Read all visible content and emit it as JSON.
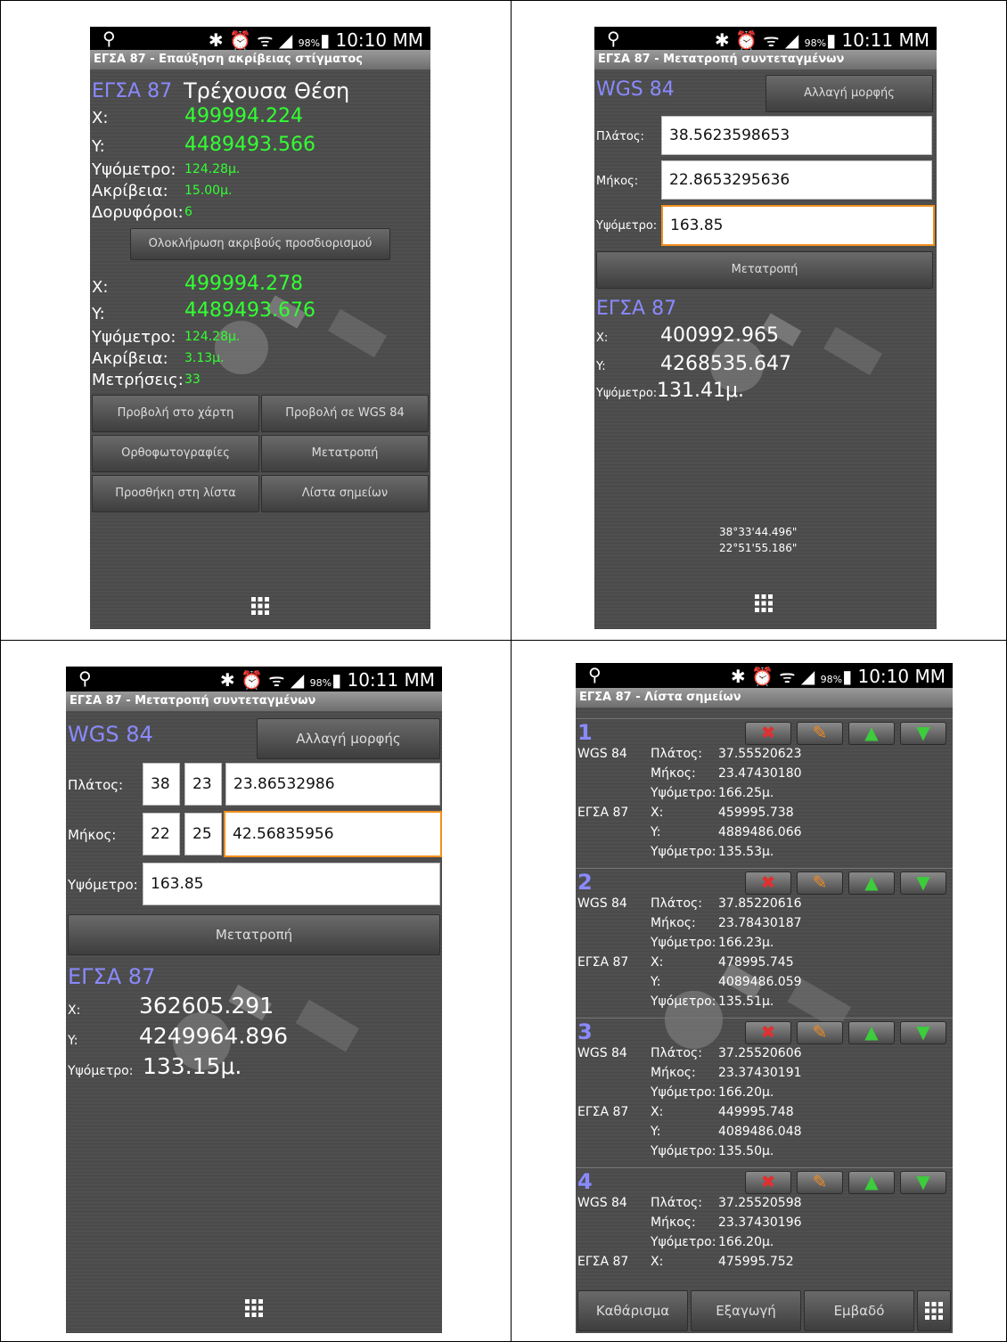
{
  "status": {
    "location_icon": "location-pin-icon",
    "icons": "✱ ⏰ ᯤ ◢",
    "battery": "98%",
    "time_a": "10:10 MM",
    "time_b": "10:11 MM"
  },
  "screen1": {
    "title": "ΕΓΣΑ 87 - Επαύξηση ακρίβειας στίγματος",
    "system": "ΕΓΣΑ 87",
    "current_position": "Τρέχουσα Θέση",
    "x_label": "X:",
    "x_value": "499994.224",
    "y_label": "Y:",
    "y_value": "4489493.566",
    "alt_label": "Υψόμετρο:",
    "alt_value": "124.28μ.",
    "acc_label": "Ακρίβεια:",
    "acc_value": "15.00μ.",
    "sat_label": "Δορυφόροι:",
    "sat_value": "6",
    "complete_button": "Ολοκλήρωση ακριβούς προσδιορισμού",
    "x2_label": "X:",
    "x2_value": "499994.278",
    "y2_label": "Y:",
    "y2_value": "4489493.676",
    "alt2_label": "Υψόμετρο:",
    "alt2_value": "124.28μ.",
    "acc2_label": "Ακρίβεια:",
    "acc2_value": "3.13μ.",
    "meas_label": "Μετρήσεις:",
    "meas_value": "33",
    "buttons": [
      "Προβολή στο χάρτη",
      "Προβολή σε WGS 84",
      "Ορθοφωτογραφίες",
      "Μετατροπή",
      "Προσθήκη στη λίστα",
      "Λίστα σημείων"
    ]
  },
  "screen2": {
    "title": "ΕΓΣΑ 87 - Μετατροπή συντεταγμένων",
    "system": "WGS 84",
    "change_format": "Αλλαγή μορφής",
    "lat_label": "Πλάτος:",
    "lat_value": "38.5623598653",
    "lon_label": "Μήκος:",
    "lon_value": "22.8653295636",
    "alt_label": "Υψόμετρο:",
    "alt_value": "163.85",
    "convert_button": "Μετατροπή",
    "result_system": "ΕΓΣΑ 87",
    "x_label": "X:",
    "x_value": "400992.965",
    "y_label": "Y:",
    "y_value": "4268535.647",
    "ralt_label": "Υψόμετρο:",
    "ralt_value": "131.41μ.",
    "dms_lat": "38°33'44.496\"",
    "dms_lon": "22°51'55.186\""
  },
  "screen3": {
    "title": "ΕΓΣΑ 87 - Μετατροπή συντεταγμένων",
    "system": "WGS 84",
    "change_format": "Αλλαγή μορφής",
    "lat_label": "Πλάτος:",
    "lat_deg": "38",
    "lat_min": "23",
    "lat_sec": "23.86532986",
    "lon_label": "Μήκος:",
    "lon_deg": "22",
    "lon_min": "25",
    "lon_sec": "42.56835956",
    "alt_label": "Υψόμετρο:",
    "alt_value": "163.85",
    "convert_button": "Μετατροπή",
    "result_system": "ΕΓΣΑ 87",
    "x_label": "X:",
    "x_value": "362605.291",
    "y_label": "Y:",
    "y_value": "4249964.896",
    "ralt_label": "Υψόμετρο:",
    "ralt_value": "133.15μ."
  },
  "screen4": {
    "title": "ΕΓΣΑ 87 - Λίστα σημείων",
    "wgs_label": "WGS 84",
    "egsa_label": "ΕΓΣΑ 87",
    "lat_label": "Πλάτος:",
    "lon_label": "Μήκος:",
    "alt_label": "Υψόμετρο:",
    "x_label": "X:",
    "y_label": "Y:",
    "points": [
      {
        "num": "1",
        "lat": "37.55520623",
        "lon": "23.47430180",
        "alt": "166.25μ.",
        "x": "459995.738",
        "y": "4889486.066",
        "alt2": "135.53μ."
      },
      {
        "num": "2",
        "lat": "37.85220616",
        "lon": "23.78430187",
        "alt": "166.23μ.",
        "x": "478995.745",
        "y": "4089486.059",
        "alt2": "135.51μ."
      },
      {
        "num": "3",
        "lat": "37.25520606",
        "lon": "23.37430191",
        "alt": "166.20μ.",
        "x": "449995.748",
        "y": "4089486.048",
        "alt2": "135.50μ."
      },
      {
        "num": "4",
        "lat": "37.25520598",
        "lon": "23.37430196",
        "alt": "166.20μ.",
        "x": "475995.752"
      }
    ],
    "clear_button": "Καθάρισμα",
    "export_button": "Εξαγωγή",
    "area_button": "Εμβαδό"
  },
  "icons": {
    "delete": "✖",
    "edit": "✎",
    "up": "▲",
    "down": "▼"
  }
}
